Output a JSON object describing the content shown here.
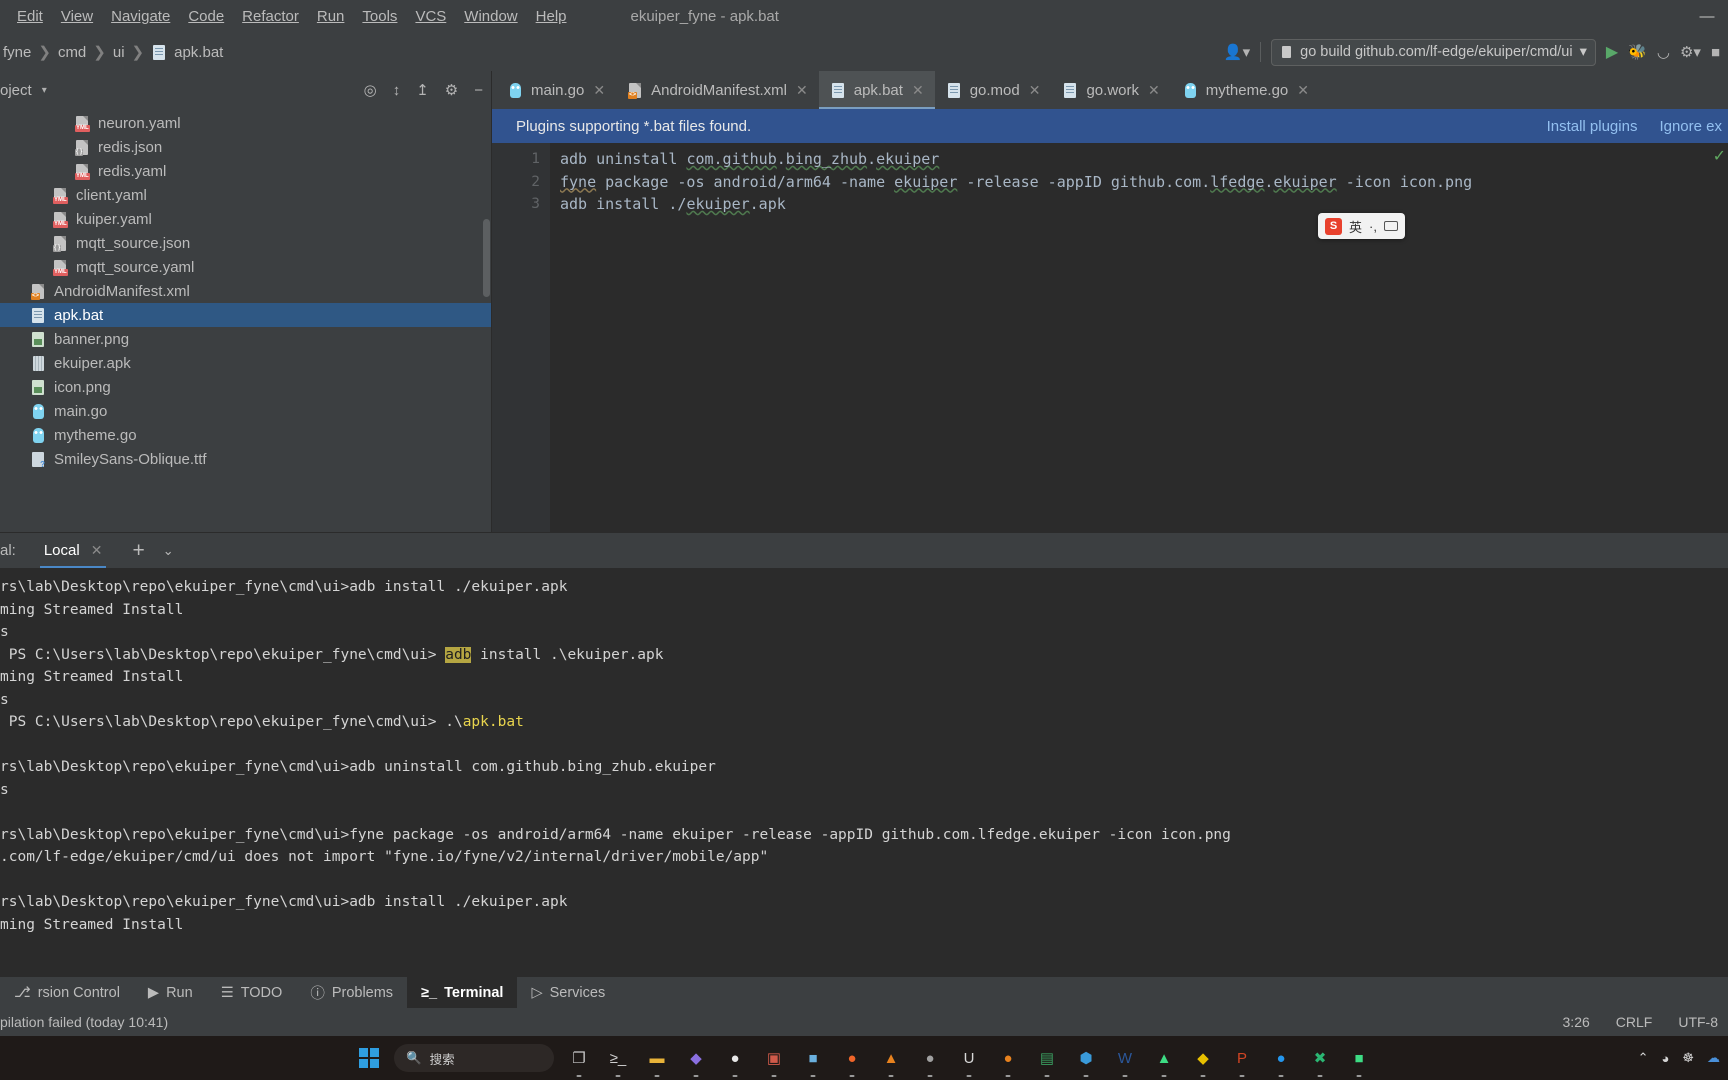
{
  "menu": {
    "items": [
      "Edit",
      "View",
      "Navigate",
      "Code",
      "Refactor",
      "Run",
      "Tools",
      "VCS",
      "Window",
      "Help"
    ],
    "window_title": "ekuiper_fyne - apk.bat",
    "minimize_label": "—",
    "maximize_label": "□",
    "close_label": "✕"
  },
  "breadcrumb": {
    "items": [
      "fyne",
      "cmd",
      "ui",
      "apk.bat"
    ],
    "separator": "❯"
  },
  "run_config": {
    "label": "go build github.com/lf-edge/ekuiper/cmd/ui",
    "dropdown_caret": "▾",
    "run_icon": "run-icon",
    "debug_icon": "debug-icon",
    "profile_icon": "profile-icon",
    "more_icon": "more-icon",
    "stop_icon": "stop-icon",
    "account_icon": "account-icon"
  },
  "project_panel": {
    "title": "oject",
    "caret": "▾",
    "toolbar_icons": [
      "locate-icon",
      "expand-all-icon",
      "collapse-all-icon",
      "settings-icon",
      "hide-icon"
    ],
    "tree": [
      {
        "label": "neuron.yaml",
        "icon": "yaml-file-icon",
        "indent": 3,
        "selected": false
      },
      {
        "label": "redis.json",
        "icon": "json-file-icon",
        "indent": 3,
        "selected": false
      },
      {
        "label": "redis.yaml",
        "icon": "yaml-file-icon",
        "indent": 3,
        "selected": false
      },
      {
        "label": "client.yaml",
        "icon": "yaml-file-icon",
        "indent": 2,
        "selected": false
      },
      {
        "label": "kuiper.yaml",
        "icon": "yaml-file-icon",
        "indent": 2,
        "selected": false
      },
      {
        "label": "mqtt_source.json",
        "icon": "json-file-icon",
        "indent": 2,
        "selected": false
      },
      {
        "label": "mqtt_source.yaml",
        "icon": "yaml-file-icon",
        "indent": 2,
        "selected": false
      },
      {
        "label": "AndroidManifest.xml",
        "icon": "xml-file-icon",
        "indent": 1,
        "selected": false
      },
      {
        "label": "apk.bat",
        "icon": "bat-file-icon",
        "indent": 1,
        "selected": true
      },
      {
        "label": "banner.png",
        "icon": "png-file-icon",
        "indent": 1,
        "selected": false
      },
      {
        "label": "ekuiper.apk",
        "icon": "apk-file-icon",
        "indent": 1,
        "selected": false
      },
      {
        "label": "icon.png",
        "icon": "png-file-icon",
        "indent": 1,
        "selected": false
      },
      {
        "label": "main.go",
        "icon": "go-file-icon",
        "indent": 1,
        "selected": false
      },
      {
        "label": "mytheme.go",
        "icon": "go-file-icon",
        "indent": 1,
        "selected": false
      },
      {
        "label": "SmileySans-Oblique.ttf",
        "icon": "ttf-file-icon",
        "indent": 1,
        "selected": false
      }
    ]
  },
  "editor_tabs": [
    {
      "label": "main.go",
      "icon": "go-file-icon",
      "active": false,
      "close": "✕"
    },
    {
      "label": "AndroidManifest.xml",
      "icon": "xml-file-icon",
      "active": false,
      "close": "✕"
    },
    {
      "label": "apk.bat",
      "icon": "bat-file-icon",
      "active": true,
      "close": "✕"
    },
    {
      "label": "go.mod",
      "icon": "bat-file-icon",
      "active": false,
      "close": "✕"
    },
    {
      "label": "go.work",
      "icon": "bat-file-icon",
      "active": false,
      "close": "✕"
    },
    {
      "label": "mytheme.go",
      "icon": "go-file-icon",
      "active": false,
      "close": "✕"
    }
  ],
  "notification": {
    "message": "Plugins supporting *.bat files found.",
    "install_label": "Install plugins",
    "ignore_label": "Ignore ex"
  },
  "code": {
    "line_numbers": [
      "1",
      "2",
      "3"
    ],
    "lines": [
      "adb uninstall com.github.bing_zhub.ekuiper",
      "fyne package -os android/arm64 -name ekuiper -release -appID github.com.lfedge.ekuiper -icon icon.png",
      "adb install ./ekuiper.apk"
    ]
  },
  "ime": {
    "logo": "S",
    "mode": "英",
    "punct": "·,",
    "keyboard_icon": "keyboard-icon"
  },
  "terminal": {
    "label": "al:",
    "tab_label": "Local",
    "tab_close": "✕",
    "add_label": "+",
    "caret_label": "⌄",
    "lines": [
      {
        "text": "rs\\lab\\Desktop\\repo\\ekuiper_fyne\\cmd\\ui>adb install ./ekuiper.apk",
        "type": "plain"
      },
      {
        "text": "ming Streamed Install",
        "type": "plain"
      },
      {
        "text": "s",
        "type": "plain"
      },
      {
        "text": " PS C:\\Users\\lab\\Desktop\\repo\\ekuiper_fyne\\cmd\\ui> adb install .\\ekuiper.apk",
        "type": "prompt-adb"
      },
      {
        "text": "ming Streamed Install",
        "type": "plain"
      },
      {
        "text": "s",
        "type": "plain"
      },
      {
        "text": " PS C:\\Users\\lab\\Desktop\\repo\\ekuiper_fyne\\cmd\\ui> .\\apk.bat",
        "type": "prompt-bat"
      },
      {
        "text": "",
        "type": "plain"
      },
      {
        "text": "rs\\lab\\Desktop\\repo\\ekuiper_fyne\\cmd\\ui>adb uninstall com.github.bing_zhub.ekuiper",
        "type": "plain"
      },
      {
        "text": "s",
        "type": "plain"
      },
      {
        "text": "",
        "type": "plain"
      },
      {
        "text": "rs\\lab\\Desktop\\repo\\ekuiper_fyne\\cmd\\ui>fyne package -os android/arm64 -name ekuiper -release -appID github.com.lfedge.ekuiper -icon icon.png",
        "type": "plain"
      },
      {
        "text": ".com/lf-edge/ekuiper/cmd/ui does not import \"fyne.io/fyne/v2/internal/driver/mobile/app\"",
        "type": "plain"
      },
      {
        "text": "",
        "type": "plain"
      },
      {
        "text": "rs\\lab\\Desktop\\repo\\ekuiper_fyne\\cmd\\ui>adb install ./ekuiper.apk",
        "type": "plain"
      },
      {
        "text": "ming Streamed Install",
        "type": "plain"
      }
    ],
    "prompt_adb": {
      "prefix": " PS C:\\Users\\lab\\Desktop\\repo\\ekuiper_fyne\\cmd\\ui> ",
      "highlight": "adb",
      "suffix": " install .\\ekuiper.apk"
    },
    "prompt_bat": {
      "prefix": " PS C:\\Users\\lab\\Desktop\\repo\\ekuiper_fyne\\cmd\\ui> .\\",
      "highlight": "apk.bat",
      "suffix": ""
    }
  },
  "toolwindow_bar": [
    {
      "label": "rsion Control",
      "icon": "version-control-icon",
      "active": false
    },
    {
      "label": "Run",
      "icon": "run-icon",
      "active": false
    },
    {
      "label": "TODO",
      "icon": "todo-icon",
      "active": false
    },
    {
      "label": "Problems",
      "icon": "problems-icon",
      "active": false
    },
    {
      "label": "Terminal",
      "icon": "terminal-icon",
      "active": true
    },
    {
      "label": "Services",
      "icon": "services-icon",
      "active": false
    }
  ],
  "status_bar": {
    "message": "pilation failed (today 10:41)",
    "caret_position": "3:26",
    "line_separator": "CRLF",
    "encoding": "UTF-8"
  },
  "taskbar": {
    "search_placeholder": "搜索",
    "search_icon": "search-icon",
    "start_icon": "windows-start-icon",
    "items": [
      {
        "name": "task-view-icon",
        "glyph": "❐",
        "color": "#c9c9c9",
        "bg": "transparent"
      },
      {
        "name": "terminal-icon",
        "glyph": "≥_",
        "color": "#cfcfcf",
        "bg": "transparent"
      },
      {
        "name": "file-explorer-icon",
        "glyph": "▬",
        "color": "#e8b339",
        "bg": "transparent"
      },
      {
        "name": "flame-icon",
        "glyph": "◆",
        "color": "#8a6fe0",
        "bg": "transparent"
      },
      {
        "name": "chrome-icon",
        "glyph": "●",
        "color": "#e8e8e8",
        "bg": "transparent"
      },
      {
        "name": "remote-desktop-icon",
        "glyph": "▣",
        "color": "#d05a4a",
        "bg": "transparent"
      },
      {
        "name": "editor-icon",
        "glyph": "■",
        "color": "#6ab0de",
        "bg": "transparent"
      },
      {
        "name": "postman-icon",
        "glyph": "●",
        "color": "#f06529",
        "bg": "transparent"
      },
      {
        "name": "vlc-icon",
        "glyph": "▲",
        "color": "#e8821e",
        "bg": "transparent"
      },
      {
        "name": "steam-icon",
        "glyph": "●",
        "color": "#a0a0a0",
        "bg": "transparent"
      },
      {
        "name": "unity-icon",
        "glyph": "U",
        "color": "#d8d8d8",
        "bg": "transparent"
      },
      {
        "name": "firefox-icon",
        "glyph": "●",
        "color": "#e8821e",
        "bg": "transparent"
      },
      {
        "name": "sheets-icon",
        "glyph": "▤",
        "color": "#3a9e60",
        "bg": "transparent"
      },
      {
        "name": "vscode-icon",
        "glyph": "⬢",
        "color": "#3a9ad9",
        "bg": "transparent"
      },
      {
        "name": "word-icon",
        "glyph": "W",
        "color": "#2b579a",
        "bg": "transparent"
      },
      {
        "name": "android-studio-icon",
        "glyph": "▲",
        "color": "#3ddc84",
        "bg": "transparent"
      },
      {
        "name": "pycharm-icon",
        "glyph": "◆",
        "color": "#e8c000",
        "bg": "transparent"
      },
      {
        "name": "powerpoint-icon",
        "glyph": "P",
        "color": "#d04423",
        "bg": "transparent"
      },
      {
        "name": "docker-icon",
        "glyph": "●",
        "color": "#2496ed",
        "bg": "transparent"
      },
      {
        "name": "xmind-icon",
        "glyph": "✖",
        "color": "#2bb673",
        "bg": "transparent"
      },
      {
        "name": "android-icon",
        "glyph": "■",
        "color": "#3ddc84",
        "bg": "transparent"
      }
    ],
    "tray": [
      {
        "name": "chevron-up-icon",
        "glyph": "⌃"
      },
      {
        "name": "volume-icon",
        "glyph": "◕"
      },
      {
        "name": "network-icon",
        "glyph": "☸"
      },
      {
        "name": "onedrive-icon",
        "glyph": "☁"
      }
    ]
  }
}
